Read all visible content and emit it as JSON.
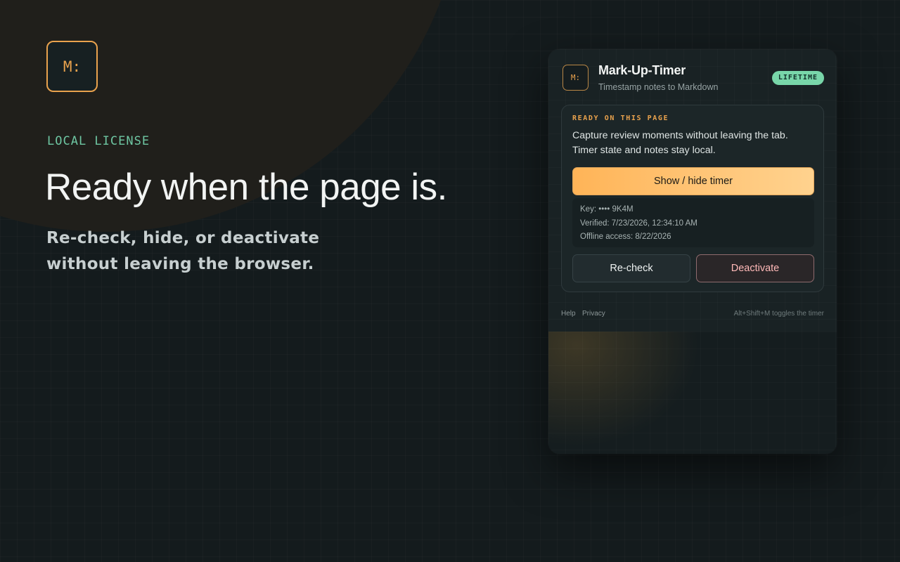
{
  "hero": {
    "logo_text": "M:",
    "eyebrow": "LOCAL LICENSE",
    "headline": "Ready when the page is.",
    "subline_1": "Re-check, hide, or deactivate",
    "subline_2": "without leaving the browser."
  },
  "popup": {
    "logo_text": "M:",
    "title": "Mark-Up-Timer",
    "subtitle": "Timestamp notes to Markdown",
    "badge": "LIFETIME",
    "card": {
      "eyebrow": "READY ON THIS PAGE",
      "description_1": "Capture review moments without leaving the tab.",
      "description_2": "Timer state and notes stay local.",
      "primary_button": "Show / hide timer",
      "license": {
        "key": "Key: •••• 9K4M",
        "verified": "Verified: 7/23/2026, 12:34:10 AM",
        "offline": "Offline access: 8/22/2026"
      },
      "recheck_button": "Re-check",
      "deactivate_button": "Deactivate"
    },
    "footer": {
      "help": "Help",
      "privacy": "Privacy",
      "shortcut_hint": "Alt+Shift+M toggles the timer"
    }
  },
  "colors": {
    "accent_orange": "#e9a24d",
    "accent_green": "#6ec6a2",
    "background": "#141b1d",
    "danger_text": "#ffb9b8"
  }
}
